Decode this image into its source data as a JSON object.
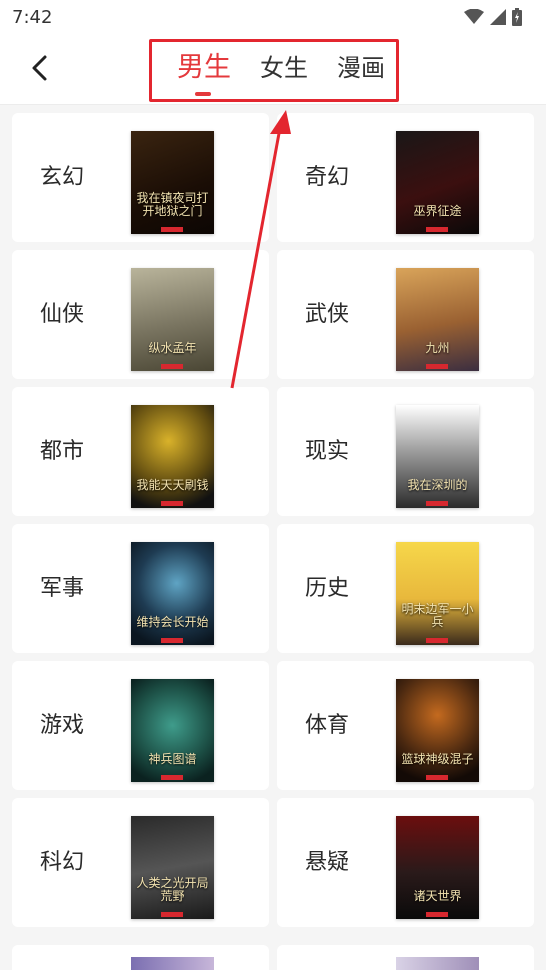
{
  "status_bar": {
    "time": "7:42"
  },
  "header": {
    "tabs": [
      {
        "label": "男生",
        "active": true
      },
      {
        "label": "女生",
        "active": false
      },
      {
        "label": "漫画",
        "active": false
      }
    ]
  },
  "colors": {
    "accent": "#e4393c",
    "annotation": "#e3262f"
  },
  "categories": [
    {
      "label": "玄幻",
      "cover_title": "我在镇夜司打开地狱之门",
      "cover_bg": "linear-gradient(160deg,#3a2410,#1a0d05 60%,#0c0603)"
    },
    {
      "label": "奇幻",
      "cover_title": "巫界征途",
      "cover_bg": "linear-gradient(160deg,#1a1717,#3b0f0f 55%,#0a0808)"
    },
    {
      "label": "仙侠",
      "cover_title": "纵水孟年",
      "cover_bg": "linear-gradient(170deg,#b9b49b,#7a7561 55%,#4a4634)"
    },
    {
      "label": "武侠",
      "cover_title": "九州",
      "cover_bg": "linear-gradient(170deg,#d9a45a,#9a6132 55%,#3b2e40)"
    },
    {
      "label": "都市",
      "cover_title": "我能天天刷钱",
      "cover_bg": "radial-gradient(circle at 45% 35%,#d9b22a,#5e4a10 55%,#111 85%)"
    },
    {
      "label": "现实",
      "cover_title": "我在深圳的",
      "cover_bg": "linear-gradient(180deg,#ffffff,#9c9c9c 45%,#2b2b2b)"
    },
    {
      "label": "军事",
      "cover_title": "维持会长开始",
      "cover_bg": "radial-gradient(circle at 55% 40%,#5fa4c4,#1e3b52 50%,#0b1620 85%)"
    },
    {
      "label": "历史",
      "cover_title": "明末边军一小兵",
      "cover_bg": "linear-gradient(180deg,#f6d74a,#e8b83c 55%,#3a2a1c)"
    },
    {
      "label": "游戏",
      "cover_title": "神兵图谱",
      "cover_bg": "radial-gradient(circle at 50% 45%,#3f9c8b,#1c4f45 55%,#0b2220 85%)"
    },
    {
      "label": "体育",
      "cover_title": "篮球神级混子",
      "cover_bg": "radial-gradient(circle at 50% 35%,#c46a1f,#4a2810 55%,#130a06 85%)"
    },
    {
      "label": "科幻",
      "cover_title": "人类之光开局荒野",
      "cover_bg": "linear-gradient(170deg,#2a2a2a,#555 50%,#1a1a1a)"
    },
    {
      "label": "悬疑",
      "cover_title": "诸天世界",
      "cover_bg": "linear-gradient(180deg,#6b0e0e,#2a1a1a 55%,#0a0a0a)"
    }
  ]
}
